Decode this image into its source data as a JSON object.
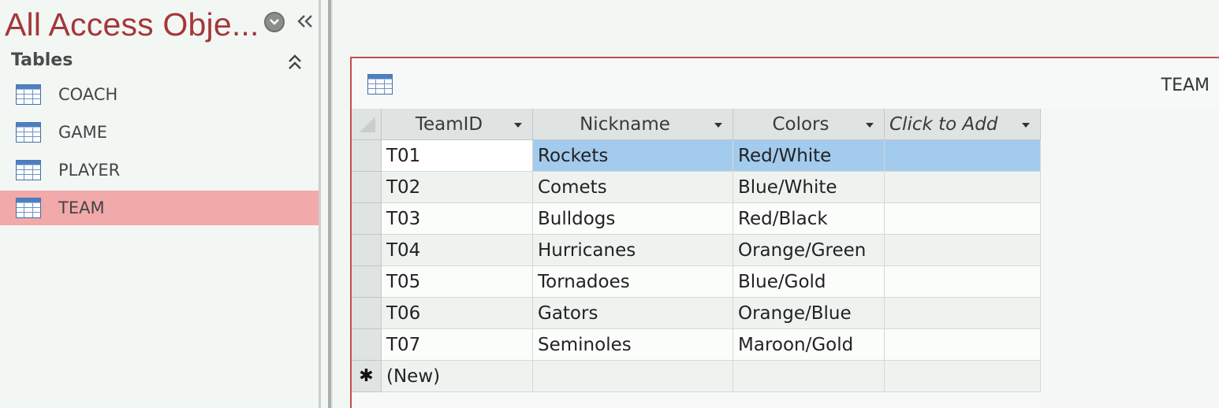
{
  "nav": {
    "title": "All Access Obje...",
    "group_label": "Tables",
    "items": [
      {
        "label": "COACH",
        "selected": false
      },
      {
        "label": "GAME",
        "selected": false
      },
      {
        "label": "PLAYER",
        "selected": false
      },
      {
        "label": "TEAM",
        "selected": true
      }
    ]
  },
  "document": {
    "tab_title": "TEAM",
    "columns": [
      {
        "label": "TeamID"
      },
      {
        "label": "Nickname"
      },
      {
        "label": "Colors"
      },
      {
        "label": "Click to Add"
      }
    ],
    "rows": [
      {
        "team_id": "T01",
        "nickname": "Rockets",
        "colors": "Red/White"
      },
      {
        "team_id": "T02",
        "nickname": "Comets",
        "colors": "Blue/White"
      },
      {
        "team_id": "T03",
        "nickname": "Bulldogs",
        "colors": "Red/Black"
      },
      {
        "team_id": "T04",
        "nickname": "Hurricanes",
        "colors": "Orange/Green"
      },
      {
        "team_id": "T05",
        "nickname": "Tornadoes",
        "colors": "Blue/Gold"
      },
      {
        "team_id": "T06",
        "nickname": "Gators",
        "colors": "Orange/Blue"
      },
      {
        "team_id": "T07",
        "nickname": "Seminoles",
        "colors": "Maroon/Gold"
      }
    ],
    "new_row_marker": "✱",
    "new_row_label": "(New)"
  },
  "colors": {
    "accent": "#a4373a",
    "selected_nav": "#f2a9aa",
    "selected_cell": "#a3cbee"
  },
  "icons": {
    "table": "table-icon",
    "menu": "chevron-circle-down-icon",
    "collapse": "double-chevron-left-icon",
    "group_collapse": "double-chevron-up-icon"
  }
}
